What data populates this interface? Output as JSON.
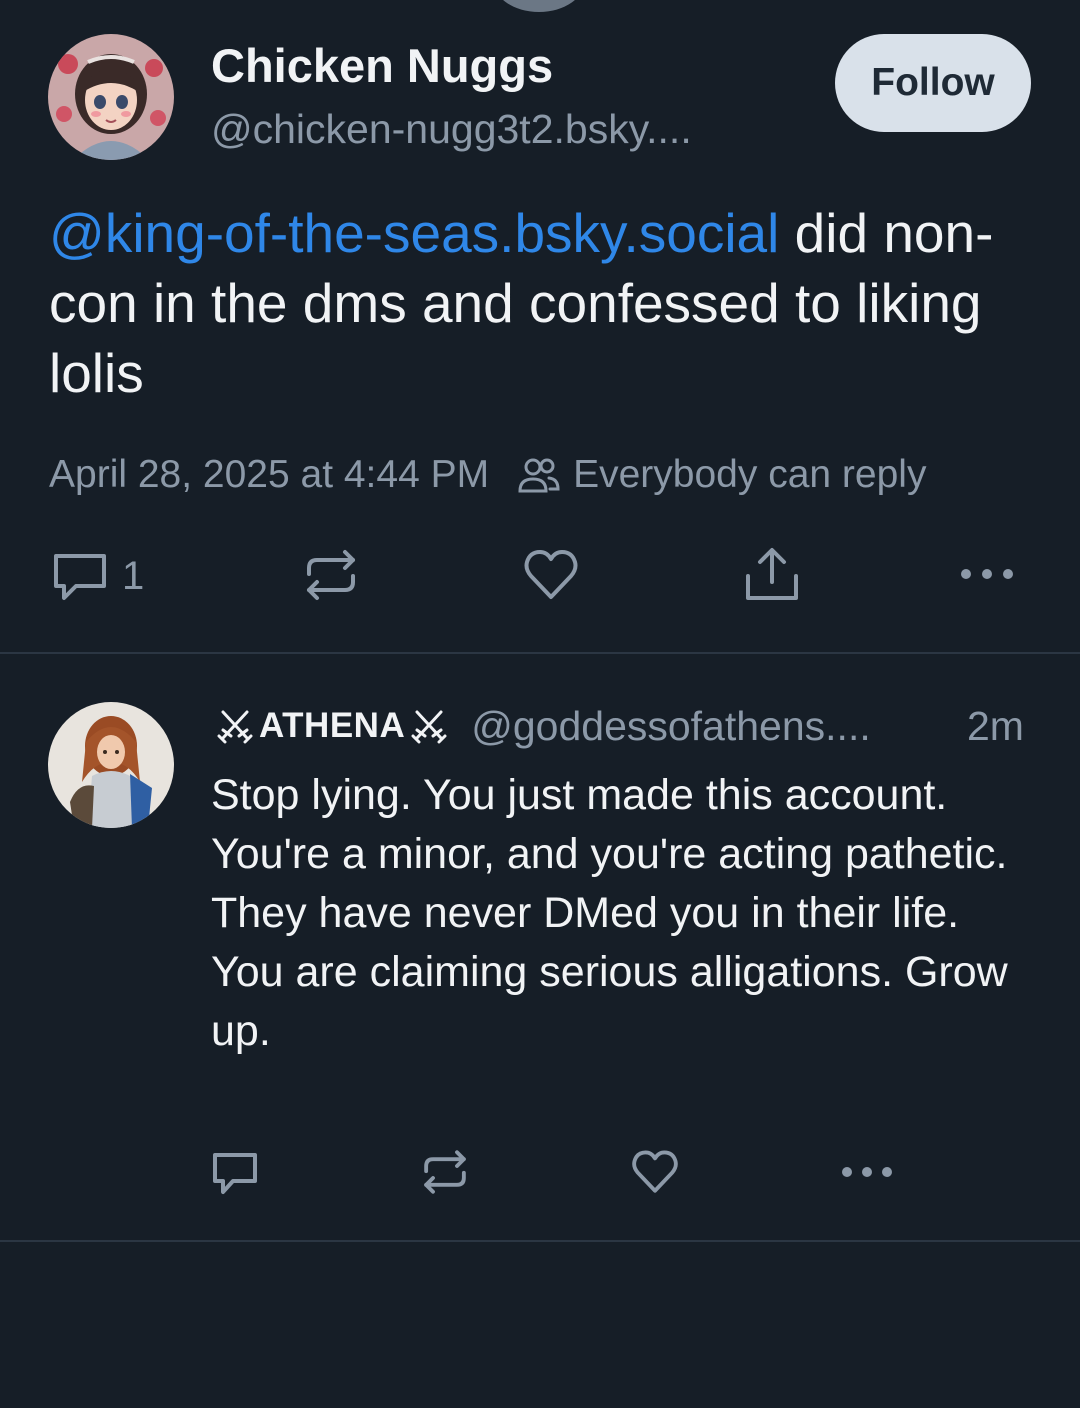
{
  "post": {
    "author": {
      "display_name": "Chicken Nuggs",
      "handle": "@chicken-nugg3t2.bsky...."
    },
    "follow_label": "Follow",
    "text": {
      "mention": "@king-of-the-seas.bsky.social",
      "rest": " did non-con in the dms and confessed to liking lolis"
    },
    "timestamp": "April 28, 2025 at 4:44 PM",
    "reply_setting": "Everybody can reply",
    "reply_count": "1",
    "icons": [
      "reply-icon",
      "repost-icon",
      "like-icon",
      "share-icon",
      "more-icon"
    ]
  },
  "reply": {
    "display_name": "ATHENA",
    "handle": "@goddessofathens....",
    "time": "2m",
    "text": "Stop lying. You just made this account. You're a minor, and you're acting pathetic. They have never DMed you in their life. You are claiming serious alligations. Grow up.",
    "icons": [
      "reply-icon",
      "repost-icon",
      "like-icon",
      "more-icon"
    ]
  },
  "colors": {
    "background": "#161e27",
    "mention": "#2f87e8",
    "muted_text": "#8c99a8",
    "follow_button": "#d9e1ea",
    "divider": "#2b3643"
  }
}
